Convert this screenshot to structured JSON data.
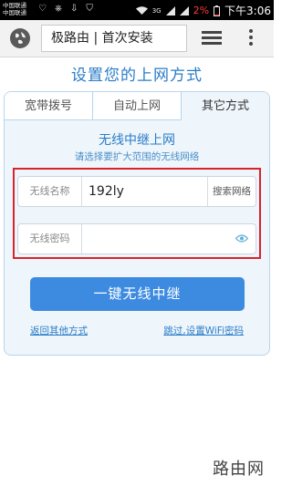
{
  "status_bar": {
    "carrier_1": "中国联通",
    "carrier_2": "中国联通",
    "network": "3G",
    "battery": "2%",
    "time": "下午3:06"
  },
  "browser": {
    "url_title": "极路由 | 首次安装",
    "icons": [
      "globe-icon",
      "tabs-icon",
      "menu-icon"
    ]
  },
  "page": {
    "title": "设置您的上网方式",
    "tabs": [
      {
        "label": "宽带拨号",
        "active": false
      },
      {
        "label": "自动上网",
        "active": false
      },
      {
        "label": "其它方式",
        "active": true
      }
    ],
    "section_title": "无线中继上网",
    "section_subtitle": "请选择要扩大范围的无线网络",
    "ssid_field": {
      "label": "无线名称",
      "value": "192ly",
      "action": "搜索网络"
    },
    "password_field": {
      "label": "无线密码",
      "value": "",
      "placeholder": ""
    },
    "primary_button": "一键无线中继",
    "link_back": "返回其他方式",
    "link_skip": "跳过,设置WiFi密码"
  },
  "watermark": "路由网",
  "colors": {
    "accent": "#2a7cc7",
    "button": "#3d8be0",
    "highlight": "#d9232d",
    "card_bg": "#eef5fb"
  }
}
